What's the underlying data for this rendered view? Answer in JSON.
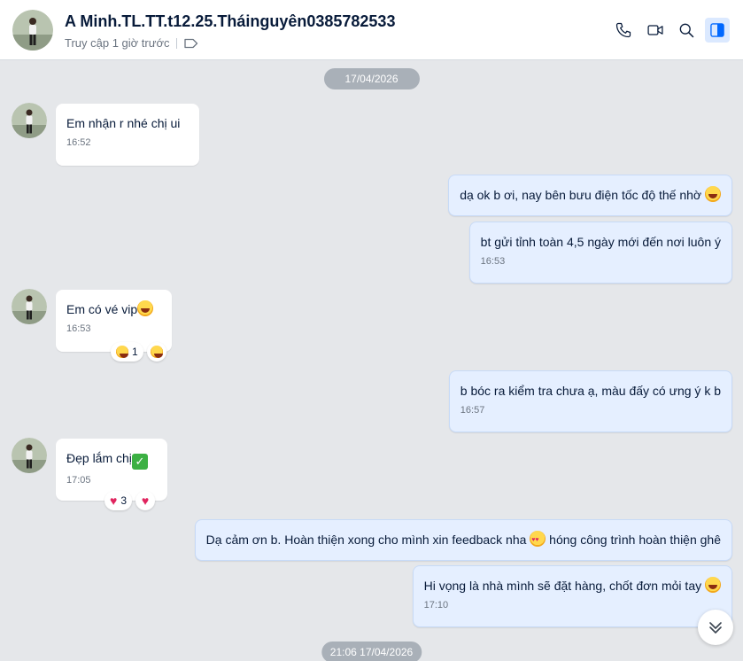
{
  "header": {
    "name": "A Minh.TL.TT.t12.25.Tháinguyên0385782533",
    "status": "Truy cập 1 giờ trước",
    "actions": [
      "phone-icon",
      "video-call-icon",
      "search-icon",
      "sidebar-toggle-icon"
    ]
  },
  "dates": {
    "first": "17/04/2026",
    "second": "21:06 17/04/2026"
  },
  "messages": [
    {
      "dir": "in",
      "text": "Em nhận r nhé chị ui",
      "time": "16:52"
    },
    {
      "dir": "out",
      "text": "dạ ok b ơi, nay bên bưu điện tốc độ thế nhờ",
      "emoji": "laughing-face"
    },
    {
      "dir": "out",
      "text": "bt gửi tỉnh toàn 4,5 ngày mới đến nơi luôn ý",
      "time": "16:53"
    },
    {
      "dir": "in",
      "text": "Em có vé vip",
      "emoji": "laughing-face",
      "time": "16:53",
      "reaction": {
        "emoji": "laughing-face",
        "count": "1"
      }
    },
    {
      "dir": "out",
      "text": "b bóc ra kiểm tra chưa ạ, màu đấy có ưng ý k b",
      "time": "16:57"
    },
    {
      "dir": "in",
      "text": "Đẹp lắm chị",
      "emoji": "check-mark",
      "time": "17:05",
      "reaction": {
        "emoji": "heart",
        "count": "3"
      }
    },
    {
      "dir": "out",
      "text": "Dạ cảm ơn b. Hoàn thiện xong cho mình xin feedback nha",
      "emoji": "heart-eyes-face",
      "text_after": " hóng công trình hoàn thiện ghê"
    },
    {
      "dir": "out",
      "text": "Hi vọng là nhà mình sẽ đặt hàng, chốt đơn mỏi tay",
      "emoji": "rofl-face",
      "time": "17:10"
    }
  ],
  "colors": {
    "background": "#e5e7ea",
    "incoming": "#ffffff",
    "outgoing": "#e5efff",
    "accent": "#0068ff"
  }
}
